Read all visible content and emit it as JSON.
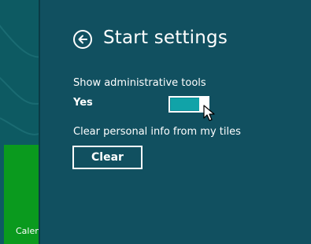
{
  "start_screen": {
    "tile_label": "Calen"
  },
  "settings": {
    "title": "Start settings",
    "back_icon": "back-arrow-circle-icon",
    "admin_tools_label": "Show administrative tools",
    "admin_tools_state": "Yes",
    "admin_tools_on": true,
    "clear_label": "Clear personal info from my tiles",
    "clear_button": "Clear"
  },
  "colors": {
    "pane_bg": "#115060",
    "start_bg": "#0d5a62",
    "tile_green": "#0a9a1e",
    "toggle_fill": "#11a3a8",
    "text": "#ffffff"
  }
}
